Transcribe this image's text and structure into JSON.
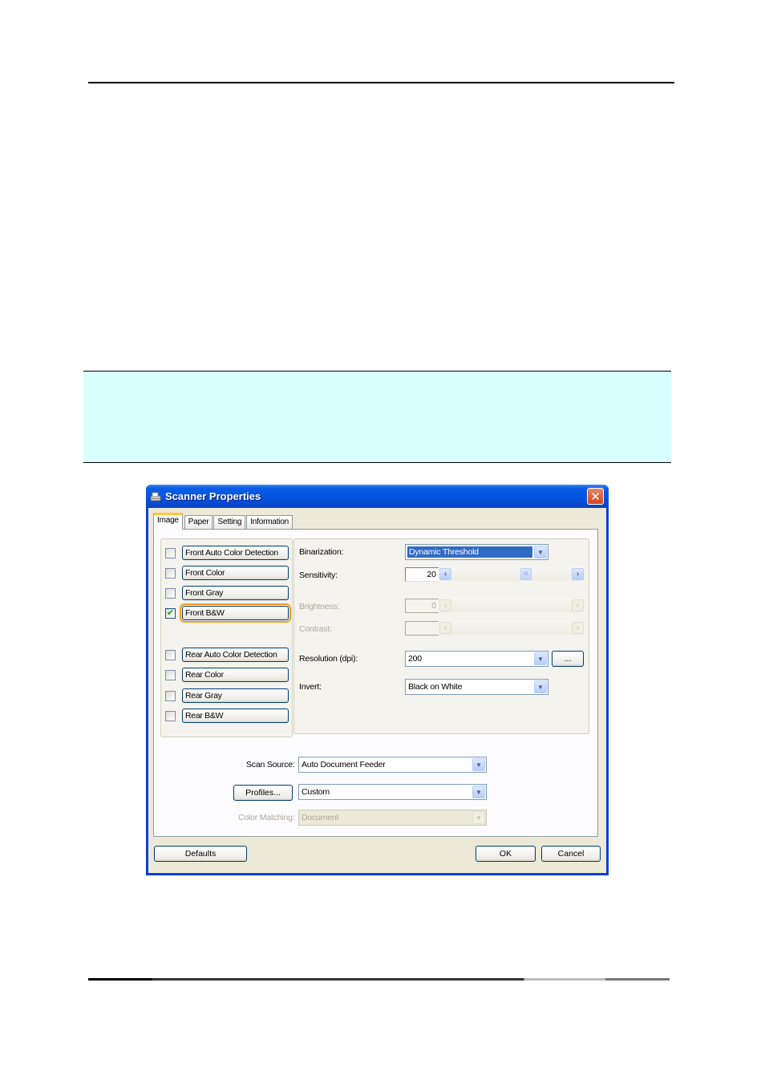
{
  "document": {
    "note_box_color": "#d9ffff"
  },
  "dialog": {
    "title": "Scanner Properties",
    "title_icon": "scanner-icon",
    "close_icon": "close-icon",
    "tabs": [
      {
        "label": "Image",
        "active": true
      },
      {
        "label": "Paper",
        "active": false
      },
      {
        "label": "Setting",
        "active": false
      },
      {
        "label": "Information",
        "active": false
      }
    ],
    "image_types": {
      "front": [
        {
          "label": "Front Auto Color Detection",
          "checked": false
        },
        {
          "label": "Front Color",
          "checked": false
        },
        {
          "label": "Front Gray",
          "checked": false
        },
        {
          "label": "Front B&W",
          "checked": true,
          "focused": true
        }
      ],
      "rear": [
        {
          "label": "Rear Auto Color Detection",
          "checked": false
        },
        {
          "label": "Rear Color",
          "checked": false
        },
        {
          "label": "Rear Gray",
          "checked": false
        },
        {
          "label": "Rear B&W",
          "checked": false
        }
      ]
    },
    "settings": {
      "binarization": {
        "label": "Binarization:",
        "value": "Dynamic Threshold"
      },
      "sensitivity": {
        "label": "Sensitivity:",
        "value": "20",
        "slider_fraction": 0.63
      },
      "brightness": {
        "label": "Brightness:",
        "value": "0",
        "disabled": true
      },
      "contrast": {
        "label": "Contrast:",
        "value": "",
        "disabled": true
      },
      "resolution": {
        "label": "Resolution (dpi):",
        "value": "200",
        "more_button": "..."
      },
      "invert": {
        "label": "Invert:",
        "value": "Black on White"
      }
    },
    "scan_source": {
      "label": "Scan Source:",
      "value": "Auto Document Feeder"
    },
    "profiles": {
      "button": "Profiles...",
      "value": "Custom"
    },
    "color_matching": {
      "label": "Color Matching:",
      "value": "Document",
      "disabled": true
    },
    "buttons": {
      "defaults": "Defaults",
      "ok": "OK",
      "cancel": "Cancel"
    },
    "icons": {
      "arrow_left": "‹",
      "arrow_right": "›",
      "dropdown": "▼",
      "check": "✔",
      "thumb": "III",
      "close": "✕"
    }
  }
}
